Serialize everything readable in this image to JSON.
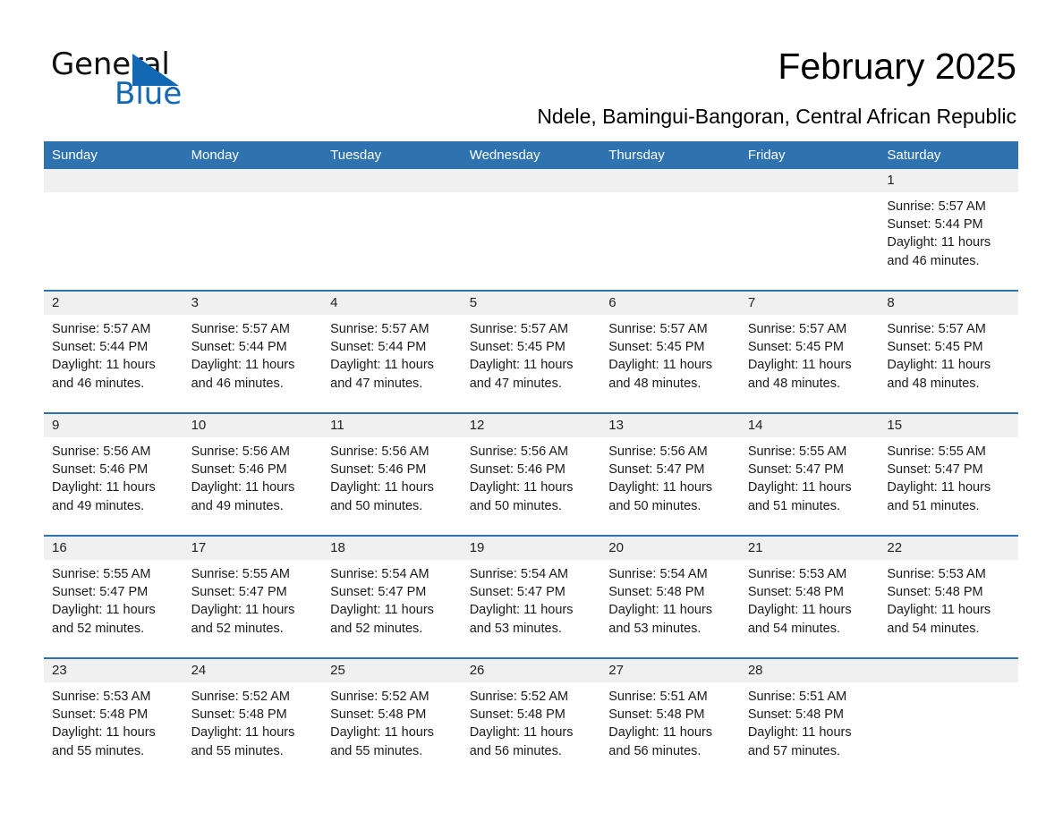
{
  "brand": {
    "name_part1": "General",
    "name_part2": "Blue",
    "triangle_color": "#1268b3"
  },
  "header": {
    "title": "February 2025",
    "subtitle": "Ndele, Bamingui-Bangoran, Central African Republic",
    "accent_color": "#2E73B0",
    "band_color": "#f0f0f0"
  },
  "calendar": {
    "weekday_headers": [
      "Sunday",
      "Monday",
      "Tuesday",
      "Wednesday",
      "Thursday",
      "Friday",
      "Saturday"
    ],
    "weeks": [
      [
        {
          "day": "",
          "empty": true
        },
        {
          "day": "",
          "empty": true
        },
        {
          "day": "",
          "empty": true
        },
        {
          "day": "",
          "empty": true
        },
        {
          "day": "",
          "empty": true
        },
        {
          "day": "",
          "empty": true
        },
        {
          "day": "1",
          "sunrise": "Sunrise: 5:57 AM",
          "sunset": "Sunset: 5:44 PM",
          "daylight1": "Daylight: 11 hours",
          "daylight2": "and 46 minutes."
        }
      ],
      [
        {
          "day": "2",
          "sunrise": "Sunrise: 5:57 AM",
          "sunset": "Sunset: 5:44 PM",
          "daylight1": "Daylight: 11 hours",
          "daylight2": "and 46 minutes."
        },
        {
          "day": "3",
          "sunrise": "Sunrise: 5:57 AM",
          "sunset": "Sunset: 5:44 PM",
          "daylight1": "Daylight: 11 hours",
          "daylight2": "and 46 minutes."
        },
        {
          "day": "4",
          "sunrise": "Sunrise: 5:57 AM",
          "sunset": "Sunset: 5:44 PM",
          "daylight1": "Daylight: 11 hours",
          "daylight2": "and 47 minutes."
        },
        {
          "day": "5",
          "sunrise": "Sunrise: 5:57 AM",
          "sunset": "Sunset: 5:45 PM",
          "daylight1": "Daylight: 11 hours",
          "daylight2": "and 47 minutes."
        },
        {
          "day": "6",
          "sunrise": "Sunrise: 5:57 AM",
          "sunset": "Sunset: 5:45 PM",
          "daylight1": "Daylight: 11 hours",
          "daylight2": "and 48 minutes."
        },
        {
          "day": "7",
          "sunrise": "Sunrise: 5:57 AM",
          "sunset": "Sunset: 5:45 PM",
          "daylight1": "Daylight: 11 hours",
          "daylight2": "and 48 minutes."
        },
        {
          "day": "8",
          "sunrise": "Sunrise: 5:57 AM",
          "sunset": "Sunset: 5:45 PM",
          "daylight1": "Daylight: 11 hours",
          "daylight2": "and 48 minutes."
        }
      ],
      [
        {
          "day": "9",
          "sunrise": "Sunrise: 5:56 AM",
          "sunset": "Sunset: 5:46 PM",
          "daylight1": "Daylight: 11 hours",
          "daylight2": "and 49 minutes."
        },
        {
          "day": "10",
          "sunrise": "Sunrise: 5:56 AM",
          "sunset": "Sunset: 5:46 PM",
          "daylight1": "Daylight: 11 hours",
          "daylight2": "and 49 minutes."
        },
        {
          "day": "11",
          "sunrise": "Sunrise: 5:56 AM",
          "sunset": "Sunset: 5:46 PM",
          "daylight1": "Daylight: 11 hours",
          "daylight2": "and 50 minutes."
        },
        {
          "day": "12",
          "sunrise": "Sunrise: 5:56 AM",
          "sunset": "Sunset: 5:46 PM",
          "daylight1": "Daylight: 11 hours",
          "daylight2": "and 50 minutes."
        },
        {
          "day": "13",
          "sunrise": "Sunrise: 5:56 AM",
          "sunset": "Sunset: 5:47 PM",
          "daylight1": "Daylight: 11 hours",
          "daylight2": "and 50 minutes."
        },
        {
          "day": "14",
          "sunrise": "Sunrise: 5:55 AM",
          "sunset": "Sunset: 5:47 PM",
          "daylight1": "Daylight: 11 hours",
          "daylight2": "and 51 minutes."
        },
        {
          "day": "15",
          "sunrise": "Sunrise: 5:55 AM",
          "sunset": "Sunset: 5:47 PM",
          "daylight1": "Daylight: 11 hours",
          "daylight2": "and 51 minutes."
        }
      ],
      [
        {
          "day": "16",
          "sunrise": "Sunrise: 5:55 AM",
          "sunset": "Sunset: 5:47 PM",
          "daylight1": "Daylight: 11 hours",
          "daylight2": "and 52 minutes."
        },
        {
          "day": "17",
          "sunrise": "Sunrise: 5:55 AM",
          "sunset": "Sunset: 5:47 PM",
          "daylight1": "Daylight: 11 hours",
          "daylight2": "and 52 minutes."
        },
        {
          "day": "18",
          "sunrise": "Sunrise: 5:54 AM",
          "sunset": "Sunset: 5:47 PM",
          "daylight1": "Daylight: 11 hours",
          "daylight2": "and 52 minutes."
        },
        {
          "day": "19",
          "sunrise": "Sunrise: 5:54 AM",
          "sunset": "Sunset: 5:47 PM",
          "daylight1": "Daylight: 11 hours",
          "daylight2": "and 53 minutes."
        },
        {
          "day": "20",
          "sunrise": "Sunrise: 5:54 AM",
          "sunset": "Sunset: 5:48 PM",
          "daylight1": "Daylight: 11 hours",
          "daylight2": "and 53 minutes."
        },
        {
          "day": "21",
          "sunrise": "Sunrise: 5:53 AM",
          "sunset": "Sunset: 5:48 PM",
          "daylight1": "Daylight: 11 hours",
          "daylight2": "and 54 minutes."
        },
        {
          "day": "22",
          "sunrise": "Sunrise: 5:53 AM",
          "sunset": "Sunset: 5:48 PM",
          "daylight1": "Daylight: 11 hours",
          "daylight2": "and 54 minutes."
        }
      ],
      [
        {
          "day": "23",
          "sunrise": "Sunrise: 5:53 AM",
          "sunset": "Sunset: 5:48 PM",
          "daylight1": "Daylight: 11 hours",
          "daylight2": "and 55 minutes."
        },
        {
          "day": "24",
          "sunrise": "Sunrise: 5:52 AM",
          "sunset": "Sunset: 5:48 PM",
          "daylight1": "Daylight: 11 hours",
          "daylight2": "and 55 minutes."
        },
        {
          "day": "25",
          "sunrise": "Sunrise: 5:52 AM",
          "sunset": "Sunset: 5:48 PM",
          "daylight1": "Daylight: 11 hours",
          "daylight2": "and 55 minutes."
        },
        {
          "day": "26",
          "sunrise": "Sunrise: 5:52 AM",
          "sunset": "Sunset: 5:48 PM",
          "daylight1": "Daylight: 11 hours",
          "daylight2": "and 56 minutes."
        },
        {
          "day": "27",
          "sunrise": "Sunrise: 5:51 AM",
          "sunset": "Sunset: 5:48 PM",
          "daylight1": "Daylight: 11 hours",
          "daylight2": "and 56 minutes."
        },
        {
          "day": "28",
          "sunrise": "Sunrise: 5:51 AM",
          "sunset": "Sunset: 5:48 PM",
          "daylight1": "Daylight: 11 hours",
          "daylight2": "and 57 minutes."
        },
        {
          "day": "",
          "empty": true
        }
      ]
    ]
  }
}
